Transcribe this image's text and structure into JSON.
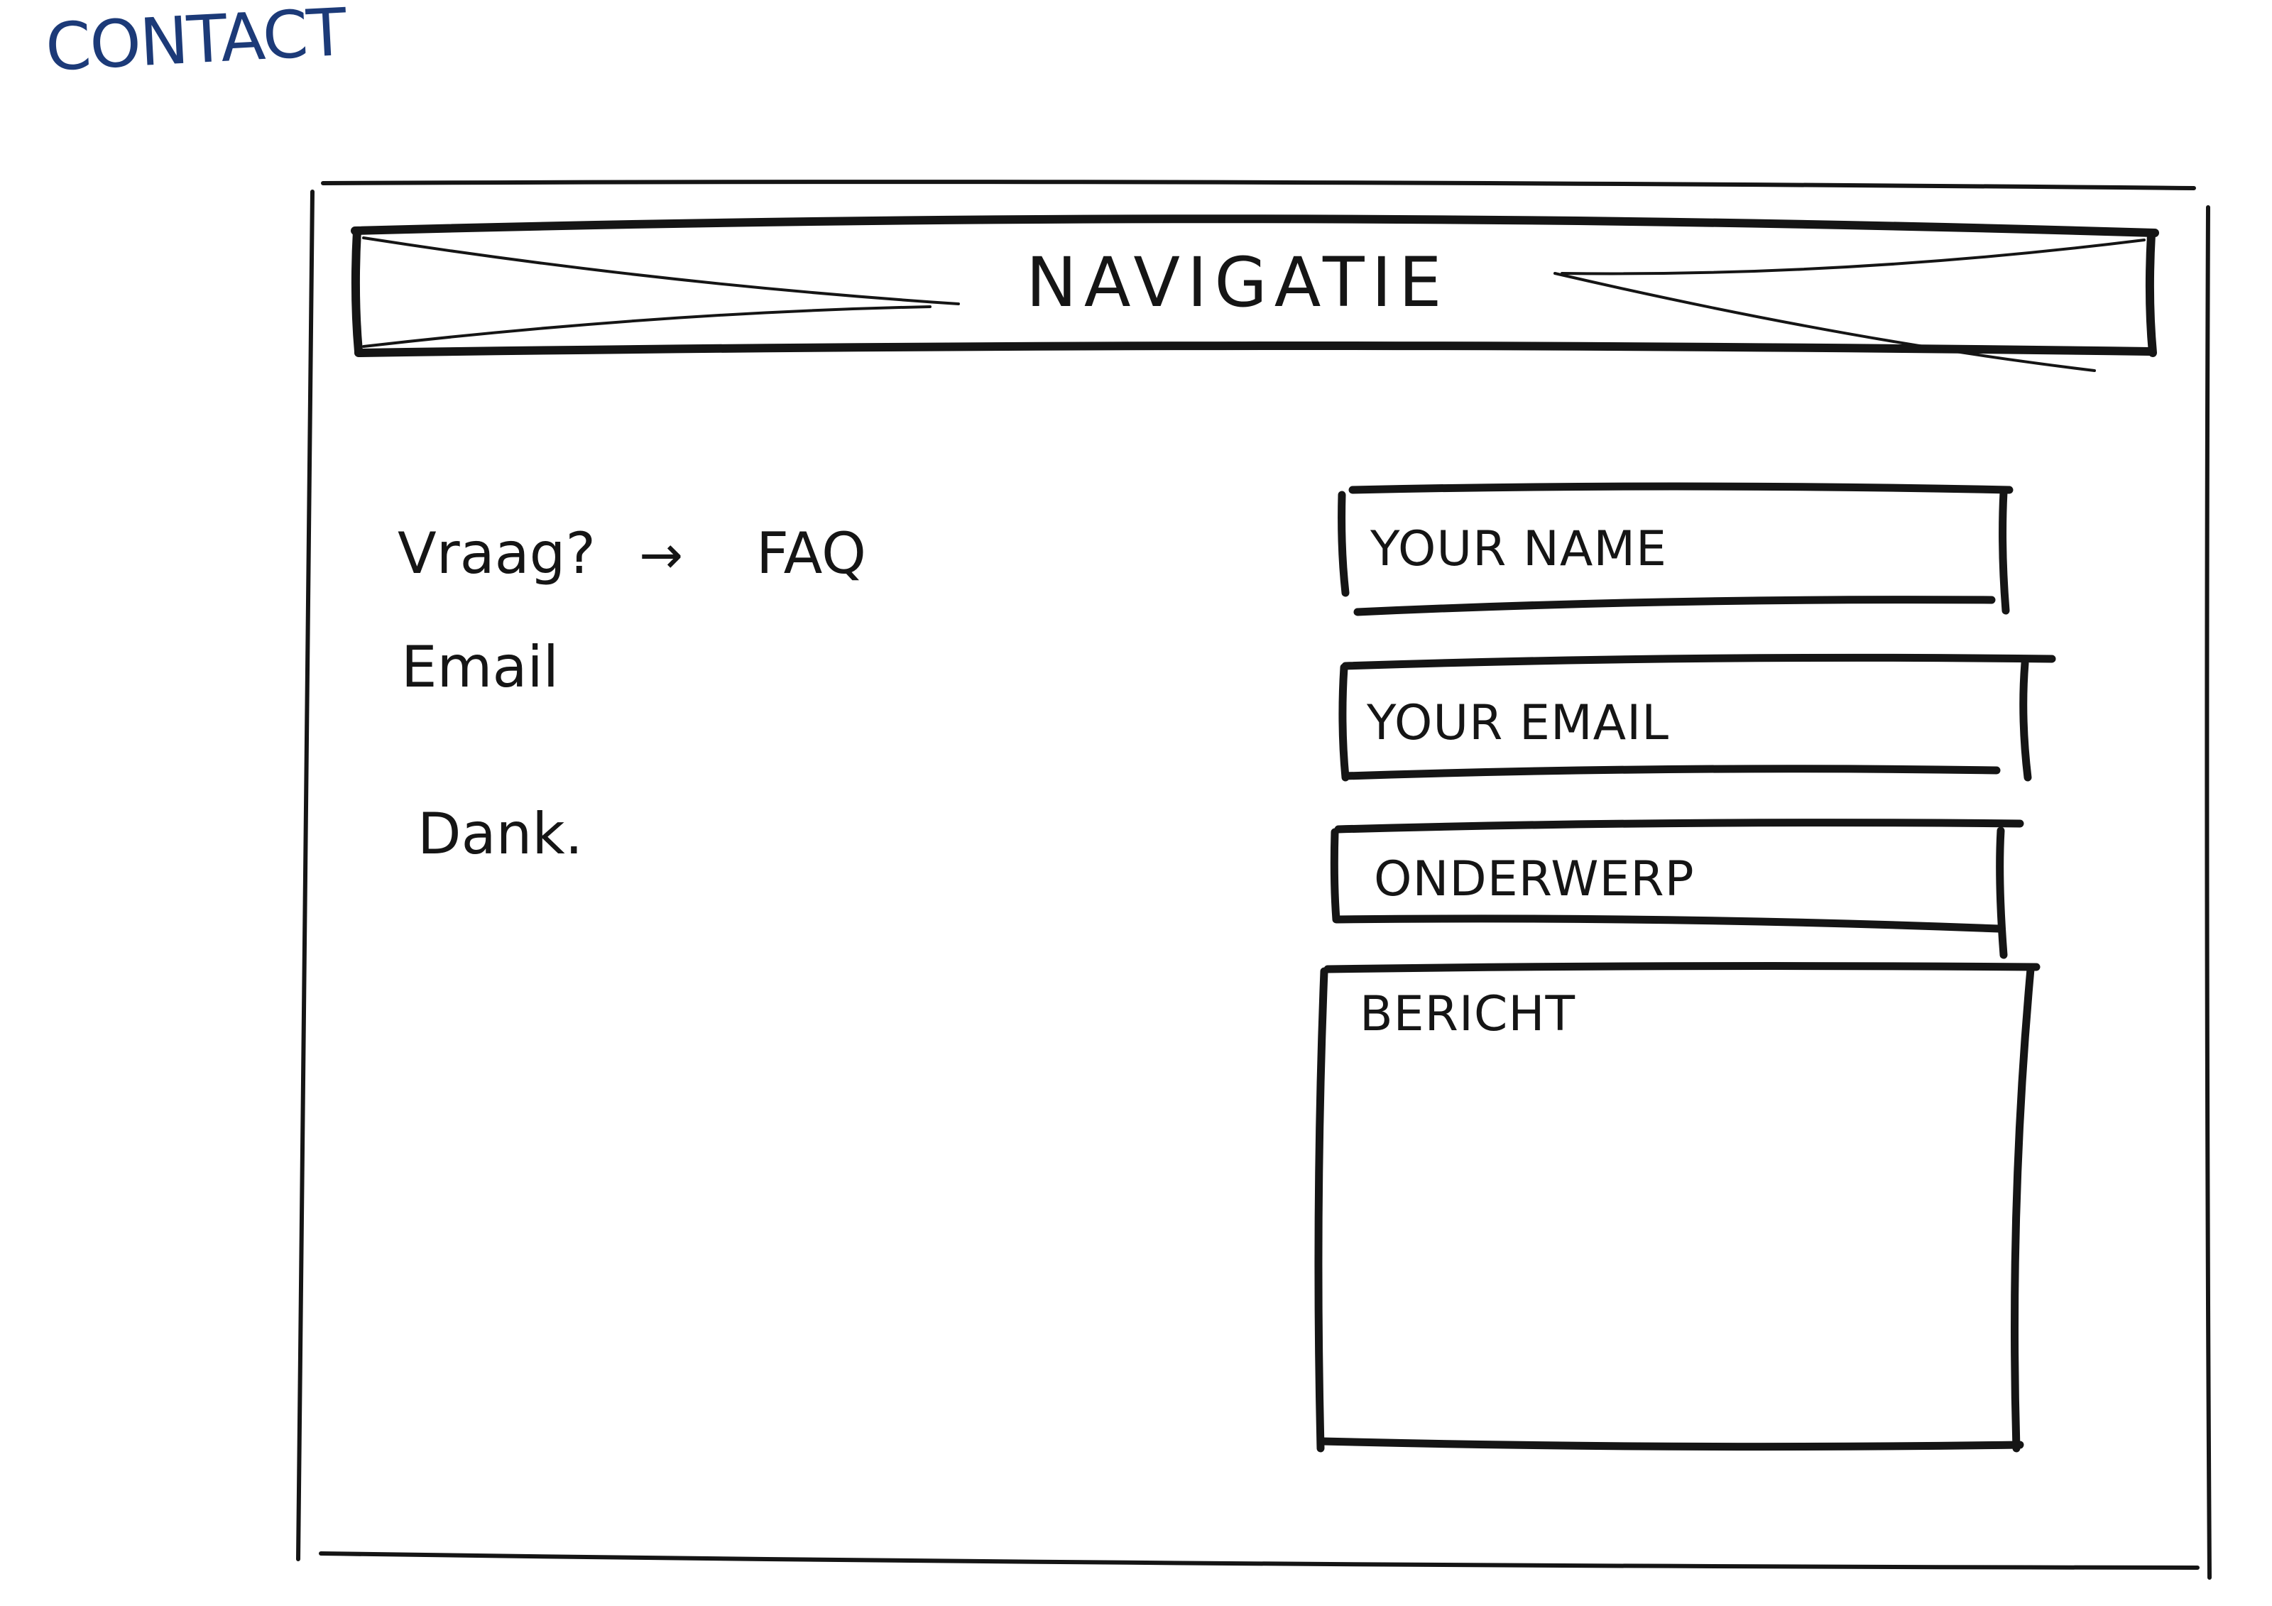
{
  "page": {
    "title": "CONTACT"
  },
  "navigation": {
    "label": "NAVIGATIE"
  },
  "info": {
    "faq_question": "Vraag?",
    "faq_arrow": "→",
    "faq_link": "FAQ",
    "email_link": "Email",
    "thanks": "Dank."
  },
  "form": {
    "name_placeholder": "YOUR NAME",
    "email_placeholder": "YOUR EMAIL",
    "subject_placeholder": "ONDERWERP",
    "message_placeholder": "BERICHT"
  },
  "colors": {
    "ink": "#151515",
    "title_ink": "#1c3a78",
    "paper": "#ffffff"
  }
}
